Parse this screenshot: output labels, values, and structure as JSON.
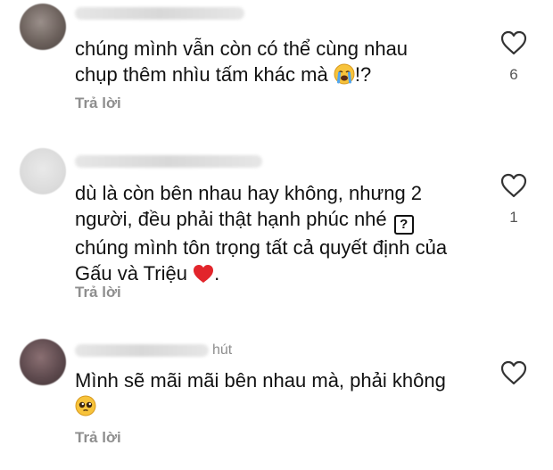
{
  "comments": [
    {
      "text_line1": "chúng mình vẫn còn có thể cùng nhau",
      "text_line2_pre": "chụp thêm nhìu tấm khác mà ",
      "emoji": "crying-face",
      "text_line2_post": "!?",
      "likes": "6",
      "reply_label": "Trả lời"
    },
    {
      "text_line1": "dù là còn bên nhau hay không, nhưng 2",
      "text_line2_pre": "người, đều phải thật hạnh phúc nhé ",
      "unknown_glyph": "?",
      "text_line3": "chúng mình tôn trọng tất cả quyết định của",
      "text_line4_pre": "Gấu và Triệu ",
      "emoji": "red-heart",
      "text_line4_post": ".",
      "likes": "1",
      "reply_label": "Trả lời"
    },
    {
      "username_suffix": "hút",
      "text_line1": "Mình sẽ mãi mãi bên nhau mà, phải không",
      "emoji": "pleading-face",
      "reply_label": "Trả lời"
    }
  ],
  "icons": {
    "like": "heart-outline-icon"
  },
  "colors": {
    "text": "#111111",
    "muted": "#8e8e8e"
  }
}
